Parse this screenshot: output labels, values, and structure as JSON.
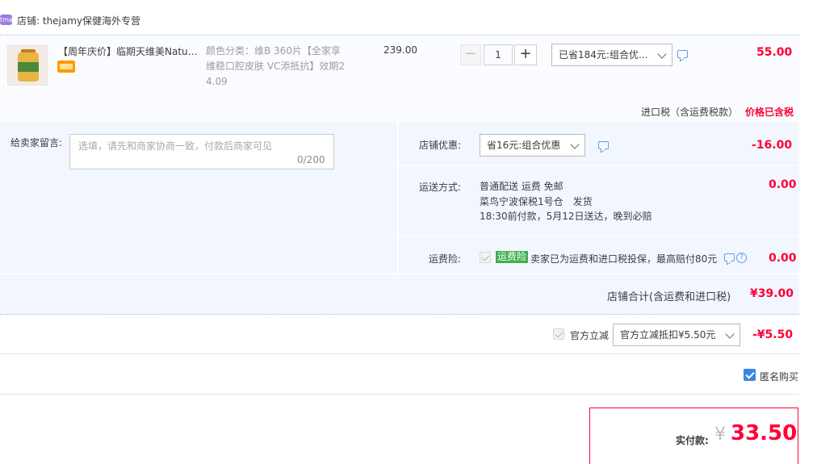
{
  "shop": {
    "icon_label": "tmall",
    "name": "店铺: thejamy保健海外专营"
  },
  "product": {
    "title": "【周年庆价】临期天维美Nature Made",
    "sku_line1": "颜色分类：维B 360片【全家享",
    "sku_line2": "维稳口腔皮肤 VC添抵抗】效期2",
    "sku_line3": "4.09",
    "price": "239.00",
    "quantity": "1",
    "qty_minus": "−",
    "qty_plus": "+",
    "promo_select": "已省184元:组合优...",
    "item_total": "55.00",
    "tax_label": "进口税（含运费税款）",
    "tax_value": "价格已含税"
  },
  "memo": {
    "label": "给卖家留言:",
    "placeholder": "选填，请先和商家协商一致，付款后商家可见",
    "count": "0/200"
  },
  "shop_discount": {
    "label": "店铺优惠:",
    "select": "省16元:组合优惠",
    "amount": "-16.00"
  },
  "shipping": {
    "label": "运送方式:",
    "line1": "普通配送 运费 免邮",
    "line2": "菜鸟宁波保税1号仓　发货",
    "line3": "18:30前付款，5月12日送达，晚到必赔",
    "amount": "0.00"
  },
  "insurance": {
    "label": "运费险:",
    "badge": "运费险",
    "text": "卖家已为运费和进口税投保，最高赔付80元",
    "amount": "0.00"
  },
  "shop_total": {
    "label": "店铺合计(含运费和进口税)",
    "value": "¥39.00"
  },
  "official_discount": {
    "label": "官方立减",
    "select": "官方立减抵扣¥5.50元",
    "value": "-¥5.50"
  },
  "anonymous": {
    "label": "匿名购买"
  },
  "payment": {
    "label": "实付款:",
    "currency": "¥",
    "amount": "33.50"
  },
  "colors": {
    "accent_red": "#ff0036",
    "panel_bg": "#f2f7ff",
    "badge_green": "#3fae4d",
    "checkbox_blue": "#3a87e0"
  }
}
